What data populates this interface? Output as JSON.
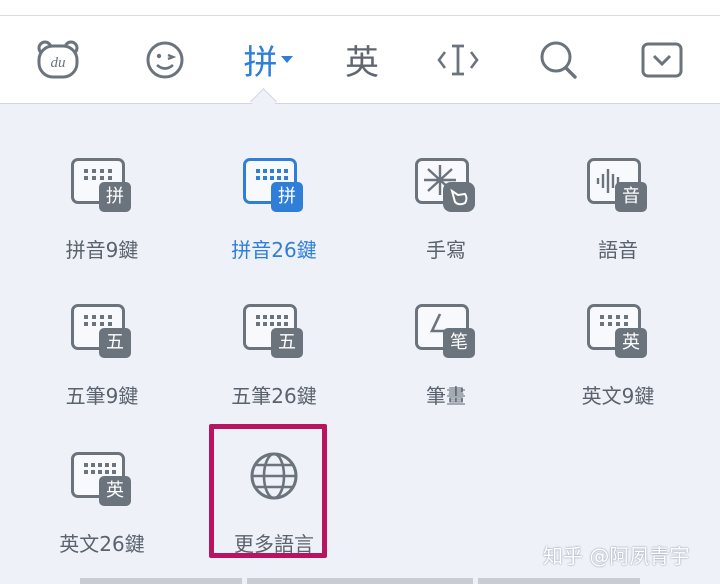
{
  "toolbar": {
    "items": [
      {
        "name": "du-logo-icon"
      },
      {
        "name": "emoji-icon"
      },
      {
        "name": "pinyin-mode",
        "label": "拼",
        "active": true
      },
      {
        "name": "english-mode",
        "label": "英"
      },
      {
        "name": "cursor-icon"
      },
      {
        "name": "search-icon"
      },
      {
        "name": "collapse-icon"
      }
    ]
  },
  "keyboards": [
    {
      "label": "拼音9鍵",
      "badge": "拼",
      "icon": "keyboard-9-icon",
      "active": false
    },
    {
      "label": "拼音26鍵",
      "badge": "拼",
      "icon": "keyboard-26-icon",
      "active": true
    },
    {
      "label": "手寫",
      "icon": "handwriting-icon",
      "active": false
    },
    {
      "label": "語音",
      "badge": "音",
      "icon": "voice-icon",
      "active": false
    },
    {
      "label": "五筆9鍵",
      "badge": "五",
      "icon": "keyboard-9-icon",
      "active": false
    },
    {
      "label": "五筆26鍵",
      "badge": "五",
      "icon": "keyboard-26-icon",
      "active": false
    },
    {
      "label": "筆畫",
      "badge": "笔",
      "icon": "stroke-icon",
      "active": false
    },
    {
      "label": "英文9鍵",
      "badge": "英",
      "icon": "keyboard-9-icon",
      "active": false
    },
    {
      "label": "英文26鍵",
      "badge": "英",
      "icon": "keyboard-26-icon",
      "active": false
    },
    {
      "label": "更多語言",
      "icon": "globe-icon",
      "active": false,
      "highlighted": true
    }
  ],
  "watermark": "知乎 @阿夙青宇",
  "colors": {
    "accent": "#2f7fd8",
    "icon_gray": "#6b737d",
    "highlight": "#b8145f",
    "panel_bg": "#eef2f8"
  }
}
